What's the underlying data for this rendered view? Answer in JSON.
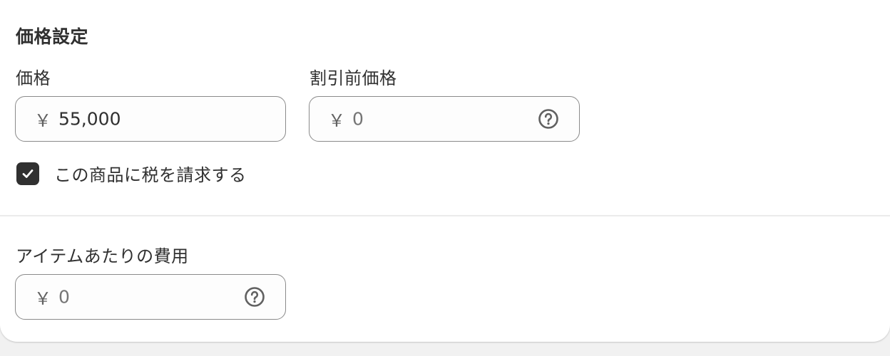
{
  "pricing": {
    "title": "価格設定",
    "price": {
      "label": "価格",
      "currency": "￥",
      "value": "55,000"
    },
    "compare_at_price": {
      "label": "割引前価格",
      "currency": "￥",
      "placeholder": "0",
      "help_icon": "question-circle-icon"
    },
    "charge_tax": {
      "label": "この商品に税を請求する",
      "checked": true
    },
    "cost_per_item": {
      "label": "アイテムあたりの費用",
      "currency": "￥",
      "placeholder": "0",
      "help_icon": "question-circle-icon"
    }
  },
  "colors": {
    "text": "#303030",
    "muted": "#616161",
    "border": "#8a8a8a",
    "checkbox": "#303030",
    "page_background": "#f1f1f1"
  }
}
